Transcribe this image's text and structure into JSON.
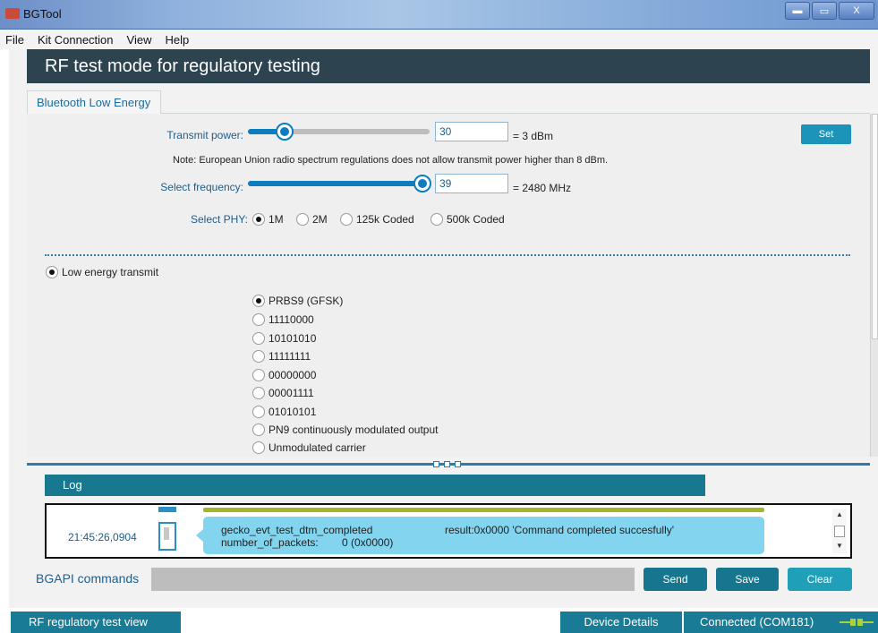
{
  "window": {
    "title": "BGTool",
    "minimize_glyph": "▬",
    "maximize_glyph": "▭",
    "close_glyph": "X"
  },
  "menu": [
    "File",
    "Kit Connection",
    "View",
    "Help"
  ],
  "header": {
    "title": "RF test mode for regulatory testing"
  },
  "tabs": [
    {
      "label": "Bluetooth Low Energy",
      "selected": true
    }
  ],
  "transmit_power": {
    "label": "Transmit power:",
    "value": "30",
    "display": "= 3 dBm",
    "slider_fraction": 0.2,
    "set_label": "Set"
  },
  "note": "Note: European Union radio spectrum regulations does not allow transmit power higher than 8 dBm.",
  "frequency": {
    "label": "Select frequency:",
    "value": "39",
    "display": "= 2480 MHz",
    "slider_fraction": 1.0
  },
  "phy": {
    "label": "Select PHY:",
    "options": [
      "1M",
      "2M",
      "125k Coded",
      "500k Coded"
    ],
    "selected": "1M"
  },
  "mode": {
    "label": "Low energy transmit",
    "selected": true
  },
  "patterns": {
    "options": [
      "PRBS9 (GFSK)",
      "11110000",
      "10101010",
      "11111111",
      "00000000",
      "00001111",
      "01010101",
      "PN9 continuously modulated output",
      "Unmodulated carrier"
    ],
    "selected": "PRBS9 (GFSK)"
  },
  "log": {
    "title": "Log",
    "entries": [
      {
        "time": "21:45:26,0904",
        "event": "gecko_evt_test_dtm_completed",
        "result": "result:0x0000 'Command completed succesfully'",
        "param": "number_of_packets:",
        "param_value": "0 (0x0000)"
      }
    ],
    "scroll_up": "▲",
    "scroll_down": "▼"
  },
  "commands": {
    "label": "BGAPI commands",
    "input_value": "",
    "send": "Send",
    "save": "Save",
    "clear": "Clear"
  },
  "status": {
    "view": "RF regulatory test view",
    "device_details": "Device Details",
    "connection": "Connected (COM181)"
  },
  "colors": {
    "header": "#2d4350",
    "accent": "#17788f",
    "slider": "#0e7dbf",
    "log_bubble": "#82d4ef",
    "connected": "#a8d13a"
  }
}
